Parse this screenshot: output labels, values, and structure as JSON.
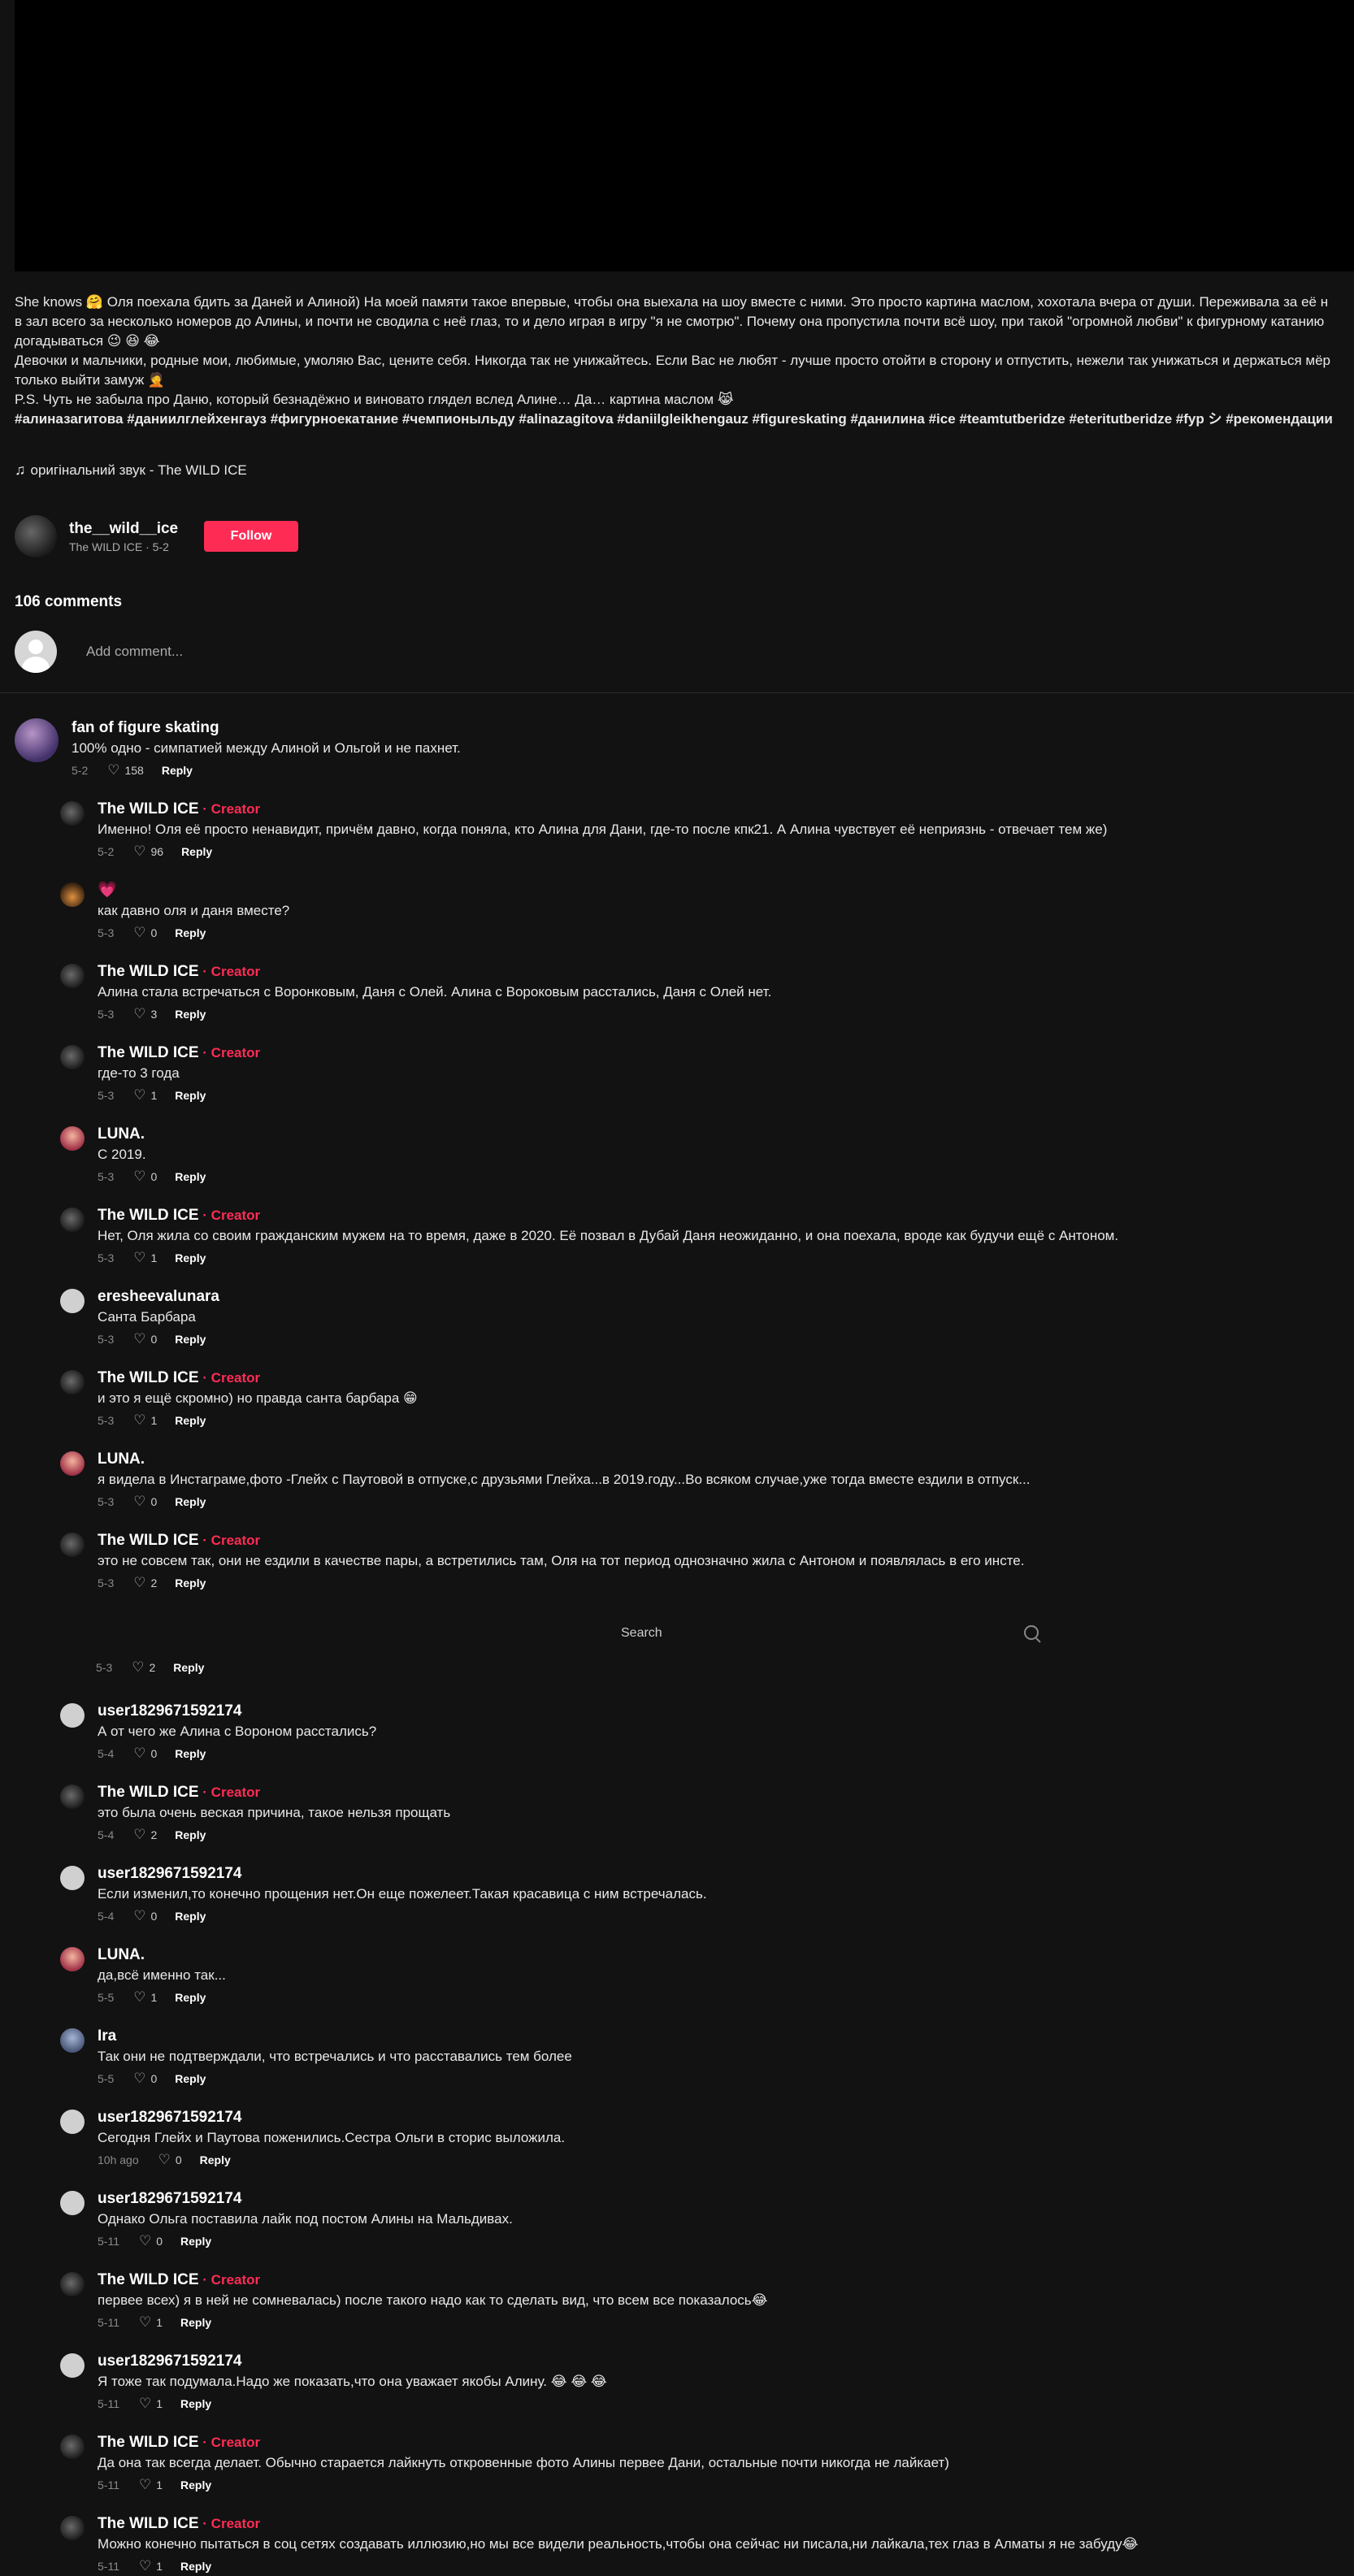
{
  "description": {
    "lines": [
      "She knows 🤗 Оля поехала бдить за Даней и Алиной) На моей памяти такое впервые, чтобы она выехала на шоу вместе с ними. Это просто картина маслом, хохотала вчера от души. Переживала за её н",
      "в зал всего за несколько номеров до Алины, и почти не сводила с неё глаз, то и дело играя в игру \"я не смотрю\". Почему она пропустила почти всё шоу, при такой \"огромной любви\" к фигурному катанию",
      "догадываться 😉 😆 😂",
      "Девочки и мальчики, родные мои, любимые, умоляю Вас, цените себя. Никогда так не унижайтесь. Если Вас не любят - лучше просто отойти в сторону и отпустить, нежели так унижаться и держаться мёр",
      "только выйти замуж 🤦",
      "P.S. Чуть не забыла про Даню, который безнадёжно и виновато глядел вслед Алине… Да… картина маслом 😹"
    ],
    "hashtags": "#алиназагитова #даниилглейхенгауз #фигурноекатание #чемпионыльду #alinazagitova #daniilgleikhengauz #figureskating #данилина #ice #teamtutberidze #eteritutberidze #fyp シ #рекомендации"
  },
  "sound": {
    "icon": "music-note-icon",
    "label": "оригінальний звук - The WILD ICE"
  },
  "author": {
    "username": "the__wild__ice",
    "subtitle": "The WILD ICE · 5-2",
    "follow_label": "Follow"
  },
  "comments_count": "106 comments",
  "add_comment": {
    "placeholder": "Add comment..."
  },
  "search": {
    "label": "Search"
  },
  "ghost_row": {
    "date": "5-3",
    "likes": "2",
    "reply": "Reply"
  },
  "comments": [
    {
      "avatar": "purple",
      "level": "top",
      "user": "fan of figure skating",
      "creator": false,
      "text": "100% одно - симпатией между Алиной и Ольгой и не пахнет.",
      "date": "5-2",
      "likes": "158",
      "reply": "Reply"
    },
    {
      "avatar": "dark",
      "level": "reply",
      "user": "The WILD ICE",
      "creator": true,
      "text": "Именно! Оля её просто ненавидит, причём давно, когда поняла, кто Алина для Дани, где-то после кпк21. А Алина чувствует её неприязнь - отвечает тем же)",
      "date": "5-2",
      "likes": "96",
      "reply": "Reply"
    },
    {
      "avatar": "flame",
      "level": "reply",
      "user": "💗",
      "creator": false,
      "text": "как давно оля и даня вместе?",
      "date": "5-3",
      "likes": "0",
      "reply": "Reply"
    },
    {
      "avatar": "dark",
      "level": "reply",
      "user": "The WILD ICE",
      "creator": true,
      "text": "Алина стала встречаться с Воронковым, Даня с Олей. Алина с Вороковым расстались, Даня с Олей нет.",
      "date": "5-3",
      "likes": "3",
      "reply": "Reply"
    },
    {
      "avatar": "dark",
      "level": "reply",
      "user": "The WILD ICE",
      "creator": true,
      "text": "где-то 3 года",
      "date": "5-3",
      "likes": "1",
      "reply": "Reply"
    },
    {
      "avatar": "luna",
      "level": "reply",
      "user": "LUNA.",
      "creator": false,
      "text": "С 2019.",
      "date": "5-3",
      "likes": "0",
      "reply": "Reply"
    },
    {
      "avatar": "dark",
      "level": "reply",
      "user": "The WILD ICE",
      "creator": true,
      "text": "Нет, Оля жила со своим гражданским мужем на то время, даже в 2020. Её позвал в Дубай Даня неожиданно, и она поехала, вроде как будучи ещё с Антоном.",
      "date": "5-3",
      "likes": "1",
      "reply": "Reply"
    },
    {
      "avatar": "grey",
      "level": "reply",
      "user": "eresheevalunara",
      "creator": false,
      "text": "Санта Барбара",
      "date": "5-3",
      "likes": "0",
      "reply": "Reply"
    },
    {
      "avatar": "dark",
      "level": "reply",
      "user": "The WILD ICE",
      "creator": true,
      "text": "и это я ещё скромно) но правда санта барбара 😁",
      "date": "5-3",
      "likes": "1",
      "reply": "Reply"
    },
    {
      "avatar": "luna",
      "level": "reply",
      "user": "LUNA.",
      "creator": false,
      "text": "я видела в Инстаграме,фото -Глейх с Паутовой в отпуске,с друзьями Глейха...в 2019.году...Во всяком случае,уже тогда вместе ездили в отпуск...",
      "date": "5-3",
      "likes": "0",
      "reply": "Reply"
    },
    {
      "avatar": "dark",
      "level": "reply",
      "user": "The WILD ICE",
      "creator": true,
      "text": "это не совсем так, они не ездили в качестве пары, а встретились там, Оля на тот период однозначно жила с Антоном и появлялась в его инсте.",
      "date": "5-3",
      "likes": "2",
      "reply": "Reply"
    },
    {
      "avatar": "grey",
      "level": "reply",
      "user": "user1829671592174",
      "creator": false,
      "text": "А от чего же Алина с Вороном расстались?",
      "date": "5-4",
      "likes": "0",
      "reply": "Reply"
    },
    {
      "avatar": "dark",
      "level": "reply",
      "user": "The WILD ICE",
      "creator": true,
      "text": "это была очень веская причина, такое нельзя прощать",
      "date": "5-4",
      "likes": "2",
      "reply": "Reply"
    },
    {
      "avatar": "grey",
      "level": "reply",
      "user": "user1829671592174",
      "creator": false,
      "text": "Если изменил,то конечно прощения нет.Он еще пожелеет.Такая красавица с ним встречалась.",
      "date": "5-4",
      "likes": "0",
      "reply": "Reply"
    },
    {
      "avatar": "luna",
      "level": "reply",
      "user": "LUNA.",
      "creator": false,
      "text": "да,всё именно так...",
      "date": "5-5",
      "likes": "1",
      "reply": "Reply"
    },
    {
      "avatar": "ira",
      "level": "reply",
      "user": "Ira",
      "creator": false,
      "text": "Так они не подтверждали, что встречались и что расставались тем более",
      "date": "5-5",
      "likes": "0",
      "reply": "Reply"
    },
    {
      "avatar": "grey",
      "level": "reply",
      "user": "user1829671592174",
      "creator": false,
      "text": "Сегодня Глейх и Паутова поженились.Сестра Ольги в сторис выложила.",
      "date": "10h ago",
      "likes": "0",
      "reply": "Reply"
    },
    {
      "avatar": "grey",
      "level": "reply",
      "user": "user1829671592174",
      "creator": false,
      "text": "Однако Ольга поставила лайк под постом Алины на Мальдивах.",
      "date": "5-11",
      "likes": "0",
      "reply": "Reply"
    },
    {
      "avatar": "dark",
      "level": "reply",
      "user": "The WILD ICE",
      "creator": true,
      "text": "первее всех) я в ней не сомневалась) после такого надо как то сделать вид, что всем все показалось😂",
      "date": "5-11",
      "likes": "1",
      "reply": "Reply"
    },
    {
      "avatar": "grey",
      "level": "reply",
      "user": "user1829671592174",
      "creator": false,
      "text": "Я тоже так подумала.Надо же показать,что она уважает якобы Алину. 😂 😂 😂",
      "date": "5-11",
      "likes": "1",
      "reply": "Reply"
    },
    {
      "avatar": "dark",
      "level": "reply",
      "user": "The WILD ICE",
      "creator": true,
      "text": "Да она так всегда делает. Обычно старается лайкнуть откровенные фото Алины первее Дани, остальные почти никогда не лайкает)",
      "date": "5-11",
      "likes": "1",
      "reply": "Reply"
    },
    {
      "avatar": "dark",
      "level": "reply",
      "user": "The WILD ICE",
      "creator": true,
      "text": "Можно конечно пытаться в соц сетях создавать иллюзию,но мы все видели реальность,чтобы она сейчас ни писала,ни лайкала,тех глаз в Алматы я не забуду😂",
      "date": "5-11",
      "likes": "1",
      "reply": "Reply"
    }
  ],
  "labels": {
    "creator_suffix": " · Creator"
  }
}
